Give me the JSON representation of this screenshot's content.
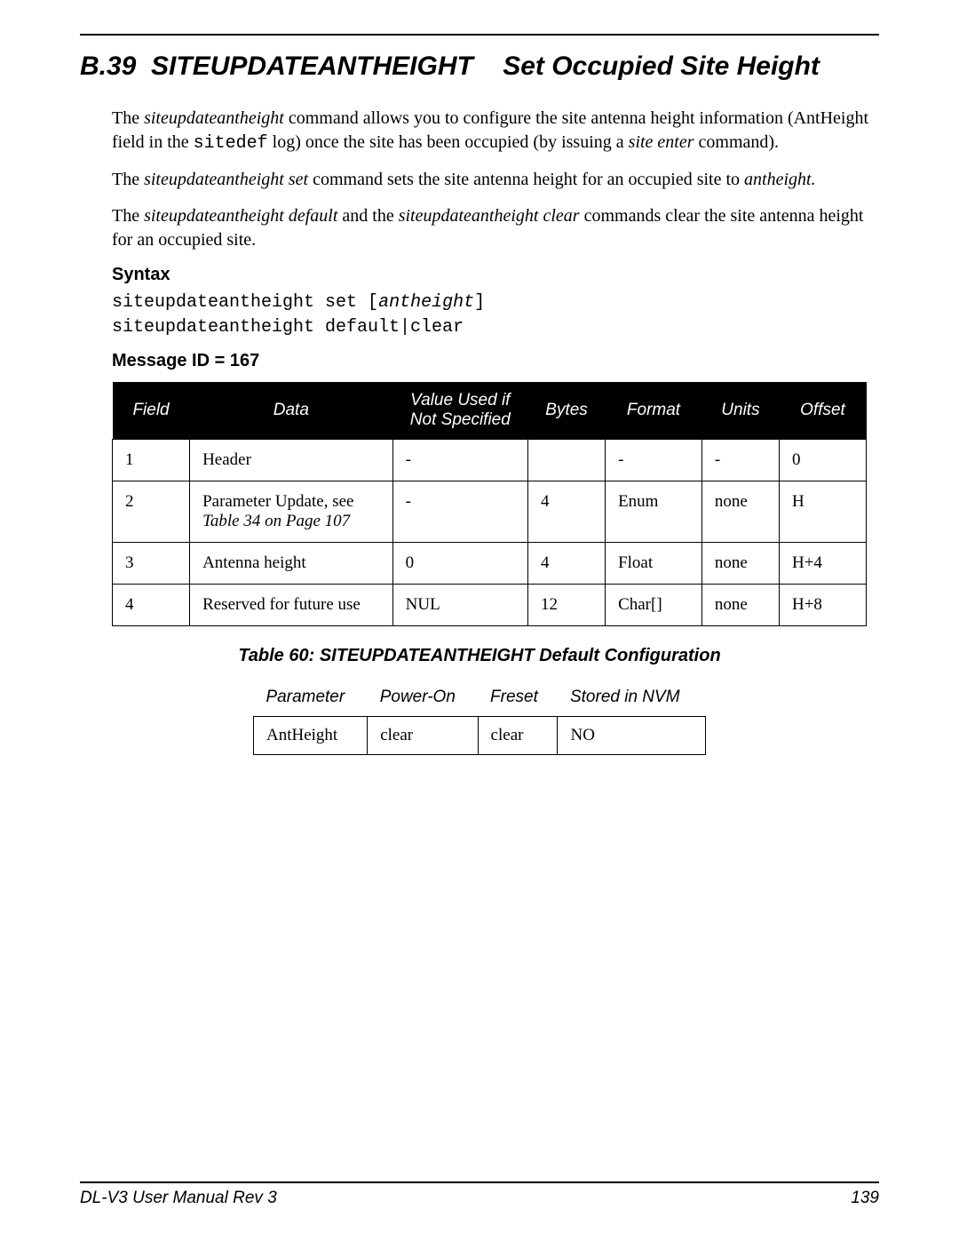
{
  "section_number": "B.39",
  "section_title_cmd": "SITEUPDATEANTHEIGHT",
  "section_title_desc": "Set Occupied Site Height",
  "para1_a": "The ",
  "para1_b": "siteupdateantheight",
  "para1_c": " command allows you to configure the site antenna height information (AntHeight field in the ",
  "para1_d": "sitedef",
  "para1_e": " log) once the site has been occupied (by issuing a ",
  "para1_f": "site enter",
  "para1_g": " command).",
  "para2_a": "The ",
  "para2_b": "siteupdateantheight set",
  "para2_c": " command sets the site antenna height for an occupied site to ",
  "para2_d": "antheight.",
  "para3_a": "The ",
  "para3_b": "siteupdateantheight default",
  "para3_c": " and the ",
  "para3_d": "siteupdateantheight clear",
  "para3_e": " commands clear the site antenna height for an occupied site.",
  "syntax_label": "Syntax",
  "syntax_line1_a": "siteupdateantheight set [",
  "syntax_line1_b": "antheight",
  "syntax_line1_c": "]",
  "syntax_line2": "siteupdateantheight default|clear",
  "msgid_label": "Message ID = 167",
  "t1": {
    "headers": [
      "Field",
      "Data",
      "Value Used if Not Specified",
      "Bytes",
      "Format",
      "Units",
      "Offset"
    ],
    "rows": [
      {
        "field": "1",
        "data_main": "Header",
        "data_ref": "",
        "val": "-",
        "bytes": "",
        "format": "-",
        "units": "-",
        "offset": "0"
      },
      {
        "field": "2",
        "data_main": "Parameter Update, see",
        "data_ref": "Table 34 on Page 107",
        "val": "-",
        "bytes": "4",
        "format": "Enum",
        "units": "none",
        "offset": "H"
      },
      {
        "field": "3",
        "data_main": "Antenna height",
        "data_ref": "",
        "val": "0",
        "bytes": "4",
        "format": "Float",
        "units": "none",
        "offset": "H+4"
      },
      {
        "field": "4",
        "data_main": "Reserved for future use",
        "data_ref": "",
        "val": "NUL",
        "bytes": "12",
        "format": "Char[]",
        "units": "none",
        "offset": "H+8"
      }
    ]
  },
  "t2_caption": "Table 60: SITEUPDATEANTHEIGHT Default Configuration",
  "t2": {
    "headers": [
      "Parameter",
      "Power-On",
      "Freset",
      "Stored in NVM"
    ],
    "rows": [
      {
        "param": "AntHeight",
        "poweron": "clear",
        "freset": "clear",
        "nvm": "NO"
      }
    ]
  },
  "footer_left": "DL-V3 User Manual Rev 3",
  "footer_right": "139"
}
